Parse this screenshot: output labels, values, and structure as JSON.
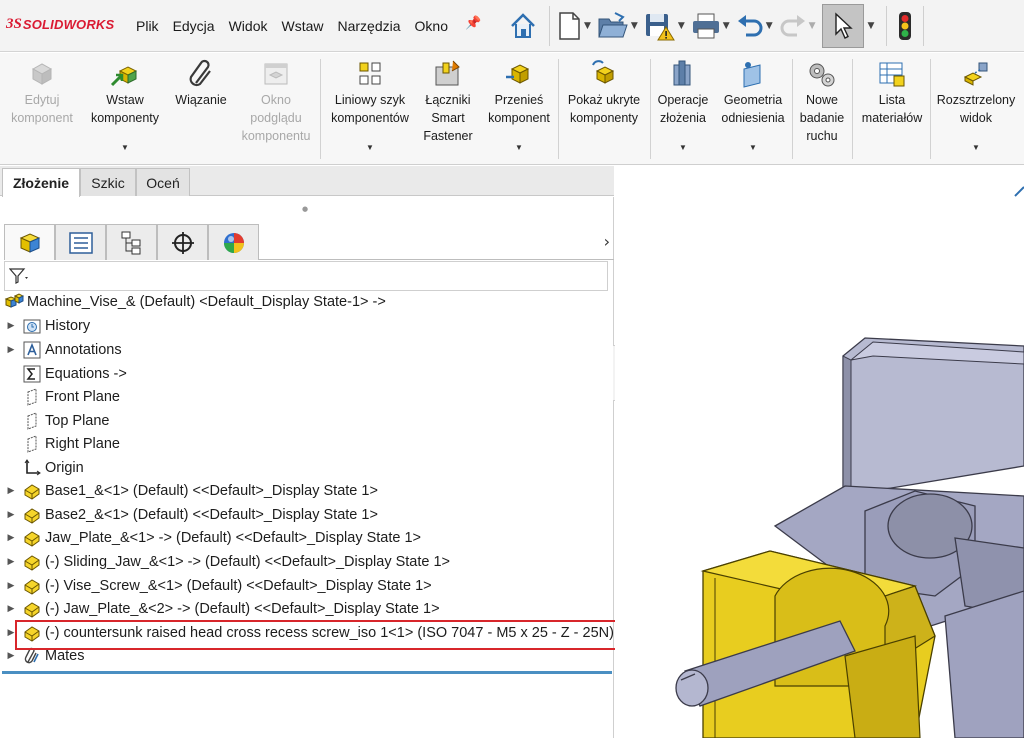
{
  "app": {
    "logo_prefix": "3S",
    "logo_name": "SOLIDWORKS"
  },
  "menu": [
    "Plik",
    "Edycja",
    "Widok",
    "Wstaw",
    "Narzędzia",
    "Okno"
  ],
  "commands": [
    {
      "label": "Edytuj\nkomponent",
      "disabled": true,
      "icon": "edit-component-icon"
    },
    {
      "label": "Wstaw\nkomponenty",
      "disabled": false,
      "icon": "insert-components-icon",
      "dropdown": true
    },
    {
      "label": "Wiązanie",
      "disabled": false,
      "icon": "mate-paperclip-icon"
    },
    {
      "label": "Okno\npodglądu\nkomponentu",
      "disabled": true,
      "icon": "preview-window-icon"
    },
    {
      "label": "Liniowy szyk\nkomponentów",
      "disabled": false,
      "icon": "linear-pattern-icon",
      "dropdown": true
    },
    {
      "label": "Łączniki\nSmart\nFastener",
      "disabled": false,
      "icon": "smart-fastener-icon"
    },
    {
      "label": "Przenieś\nkomponent",
      "disabled": false,
      "icon": "move-component-icon",
      "dropdown": true
    },
    {
      "label": "Pokaż ukryte\nkomponenty",
      "disabled": false,
      "icon": "show-hidden-icon"
    },
    {
      "label": "Operacje\nzłożenia",
      "disabled": false,
      "icon": "assembly-features-icon",
      "dropdown": true
    },
    {
      "label": "Geometria\nodniesienia",
      "disabled": false,
      "icon": "reference-geometry-icon",
      "dropdown": true
    },
    {
      "label": "Nowe\nbadanie\nruchu",
      "disabled": false,
      "icon": "motion-study-icon"
    },
    {
      "label": "Lista\nmateriałów",
      "disabled": false,
      "icon": "bom-icon"
    },
    {
      "label": "Rozsztrzelony\nwidok",
      "disabled": false,
      "icon": "exploded-view-icon",
      "dropdown": true
    }
  ],
  "tabs": [
    "Złożenie",
    "Szkic",
    "Oceń"
  ],
  "tree": {
    "root": "Machine_Vise_& (Default) <Default_Display State-1> ->",
    "items": [
      {
        "label": "History",
        "icon": "history-icon",
        "expandable": true
      },
      {
        "label": "Annotations",
        "icon": "annotations-icon",
        "expandable": true
      },
      {
        "label": "Equations ->",
        "icon": "equations-icon",
        "expandable": false
      },
      {
        "label": "Front Plane",
        "icon": "plane-icon",
        "expandable": false
      },
      {
        "label": "Top Plane",
        "icon": "plane-icon",
        "expandable": false
      },
      {
        "label": "Right Plane",
        "icon": "plane-icon",
        "expandable": false
      },
      {
        "label": "Origin",
        "icon": "origin-icon",
        "expandable": false
      },
      {
        "label": "Base1_&<1> (Default) <<Default>_Display State 1>",
        "icon": "part-icon",
        "expandable": true
      },
      {
        "label": "Base2_&<1> (Default) <<Default>_Display State 1>",
        "icon": "part-icon",
        "expandable": true
      },
      {
        "label": "Jaw_Plate_&<1> -> (Default) <<Default>_Display State 1>",
        "icon": "part-icon",
        "expandable": true
      },
      {
        "label": "(-) Sliding_Jaw_&<1> -> (Default) <<Default>_Display State 1>",
        "icon": "part-icon",
        "expandable": true
      },
      {
        "label": "(-) Vise_Screw_&<1> (Default) <<Default>_Display State 1>",
        "icon": "part-icon",
        "expandable": true
      },
      {
        "label": "(-) Jaw_Plate_&<2> -> (Default) <<Default>_Display State 1>",
        "icon": "part-icon",
        "expandable": true
      },
      {
        "label": "(-) countersunk raised head cross recess screw_iso 1<1> (ISO 7047 - M5 x 25 - Z - 25N)",
        "icon": "part-icon",
        "expandable": true
      },
      {
        "label": "Mates",
        "icon": "mates-icon",
        "expandable": true
      }
    ]
  },
  "colors": {
    "highlight": "#d8262b",
    "part_yellow": "#e8cd1f",
    "metal_gray": "#a4a7c3",
    "accent_blue": "#1f6fb5"
  }
}
